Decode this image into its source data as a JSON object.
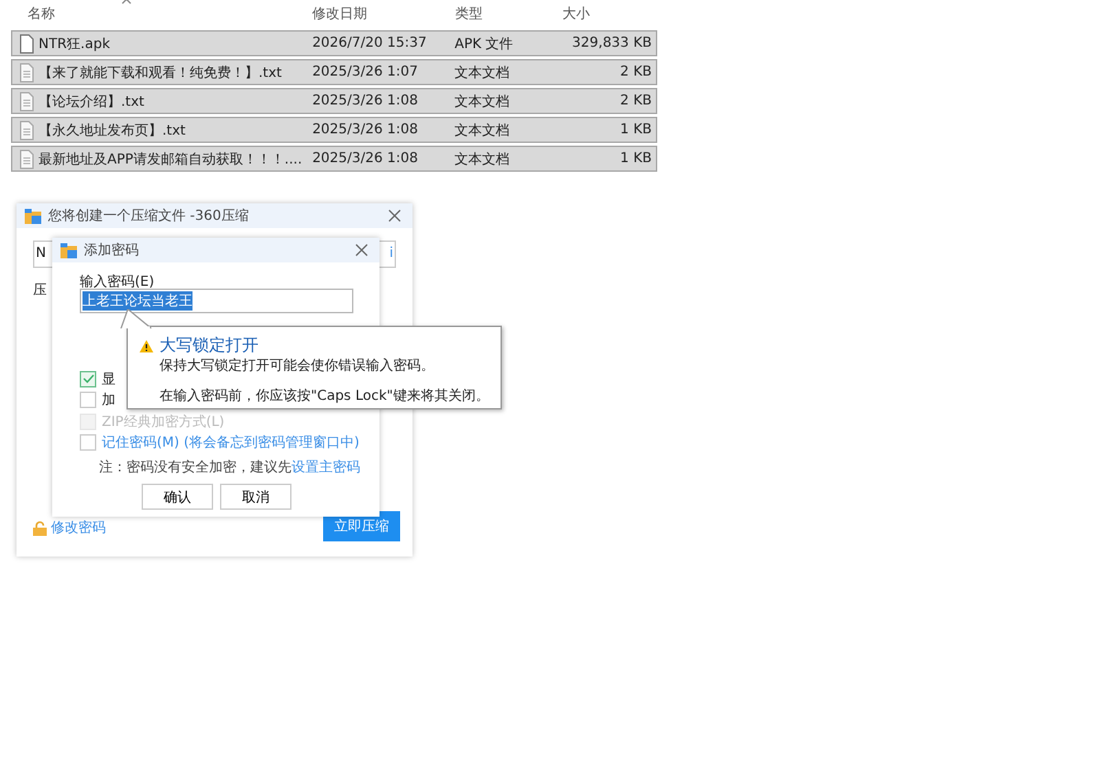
{
  "file_list": {
    "columns": [
      "名称",
      "修改日期",
      "类型",
      "大小"
    ],
    "rows": [
      {
        "name": "NTR狂.apk",
        "date": "2026/7/20 15:37",
        "type": "APK 文件",
        "size": "329,833 KB",
        "kind": "apk",
        "selected": true
      },
      {
        "name": "【来了就能下载和观看！纯免费！】.txt",
        "date": "2025/3/26 1:07",
        "type": "文本文档",
        "size": "2 KB",
        "kind": "txt",
        "selected": true
      },
      {
        "name": "【论坛介绍】.txt",
        "date": "2025/3/26 1:08",
        "type": "文本文档",
        "size": "2 KB",
        "kind": "txt",
        "selected": true
      },
      {
        "name": "【永久地址发布页】.txt",
        "date": "2025/3/26 1:08",
        "type": "文本文档",
        "size": "1 KB",
        "kind": "txt",
        "selected": true
      },
      {
        "name": "最新地址及APP请发邮箱自动获取！！！....",
        "date": "2025/3/26 1:08",
        "type": "文本文档",
        "size": "1 KB",
        "kind": "txt",
        "selected": true
      }
    ]
  },
  "archive_dialog": {
    "title": "您将创建一个压缩文件 -360压缩",
    "field_start": "N",
    "field_end": "i",
    "label_fragment": "压",
    "change_password_link": "修改密码",
    "compress_button": "立即压缩"
  },
  "password_dialog": {
    "title": "添加密码",
    "field_label": "输入密码(E)",
    "password": "上老王论坛当老王",
    "options": [
      {
        "label": "显",
        "checked": true,
        "disabled": false,
        "link": false
      },
      {
        "label": "加",
        "checked": false,
        "disabled": false,
        "link": false
      },
      {
        "label": "ZIP经典加密方式(L)",
        "checked": false,
        "disabled": true,
        "link": false
      },
      {
        "label": "记住密码(M) (将会备忘到密码管理窗口中)",
        "checked": false,
        "disabled": false,
        "link": true
      }
    ],
    "note": "注：密码没有安全加密，建议先",
    "note_link": "设置主密码",
    "buttons": [
      "确认",
      "取消"
    ]
  },
  "caps_lock_tooltip": {
    "title": "大写锁定打开",
    "lines": [
      "保持大写锁定打开可能会使你错误输入密码。",
      "在输入密码前，你应该按\"Caps Lock\"键来将其关闭。"
    ]
  }
}
